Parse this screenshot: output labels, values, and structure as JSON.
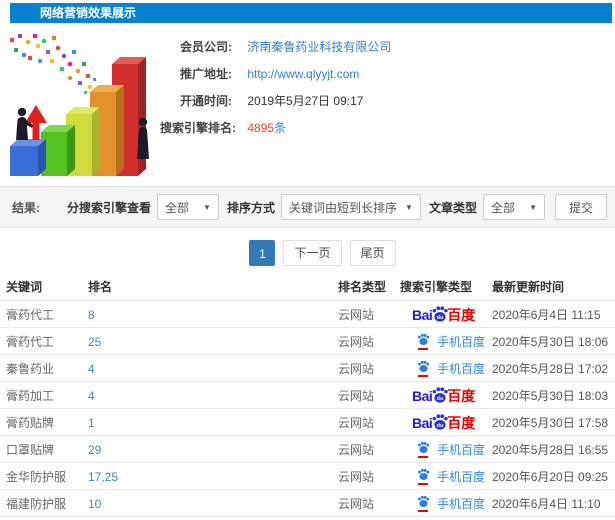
{
  "header": {
    "title": "网络营销效果展示"
  },
  "info": {
    "company_label": "会员公司:",
    "company_value": "济南秦鲁药业科技有限公司",
    "url_label": "推广地址:",
    "url_value": "http://www.qlyyjt.com",
    "open_label": "开通时间:",
    "open_value": "2019年5月27日 09:17",
    "rank_label": "搜索引擎排名:",
    "rank_count": "4895",
    "rank_unit": "条"
  },
  "filters": {
    "result_label": "结果:",
    "engine_label": "分搜索引擎查看",
    "engine_value": "全部",
    "sort_label": "排序方式",
    "sort_value": "关键词由短到长排序",
    "article_label": "文章类型",
    "article_value": "全部",
    "submit_label": "提交",
    "caret": "▼"
  },
  "pagination": {
    "page": "1",
    "next_label": "下一页",
    "last_label": "尾页"
  },
  "table": {
    "headers": [
      "关键词",
      "排名",
      "排名类型",
      "搜索引擎类型",
      "最新更新时间"
    ],
    "engine_logos": {
      "baidu_prefix": "Bai",
      "baidu_paw_text": "du",
      "baidu_suffix": "百度",
      "mobile_label": "手机百度"
    },
    "rows": [
      {
        "keyword": "膏药代工",
        "rank": "8",
        "rank_type": "云网站",
        "engine": "baidu",
        "updated": "2020年6月4日 11:15"
      },
      {
        "keyword": "膏药代工",
        "rank": "25",
        "rank_type": "云网站",
        "engine": "mobile",
        "updated": "2020年5月30日 18:06"
      },
      {
        "keyword": "秦鲁药业",
        "rank": "4",
        "rank_type": "云网站",
        "engine": "mobile",
        "updated": "2020年5月28日 17:02"
      },
      {
        "keyword": "膏药加工",
        "rank": "4",
        "rank_type": "云网站",
        "engine": "baidu",
        "updated": "2020年5月30日 18:03"
      },
      {
        "keyword": "膏药贴牌",
        "rank": "1",
        "rank_type": "云网站",
        "engine": "baidu",
        "updated": "2020年5月30日 17:58"
      },
      {
        "keyword": "口罩贴牌",
        "rank": "29",
        "rank_type": "云网站",
        "engine": "mobile",
        "updated": "2020年5月28日 16:55"
      },
      {
        "keyword": "金华防护服",
        "rank": "17,25",
        "rank_type": "云网站",
        "engine": "mobile",
        "updated": "2020年6月20日 09:25"
      },
      {
        "keyword": "福建防护服",
        "rank": "10",
        "rank_type": "云网站",
        "engine": "mobile",
        "updated": "2020年6月4日 11:10"
      }
    ]
  },
  "colors": {
    "header_blue": "#0782d0",
    "link_blue": "#2f7fd6",
    "count_red": "#e6452e",
    "active_page_blue": "#337ab7",
    "baidu_blue": "#2319dc",
    "baidu_red": "#e10602"
  }
}
